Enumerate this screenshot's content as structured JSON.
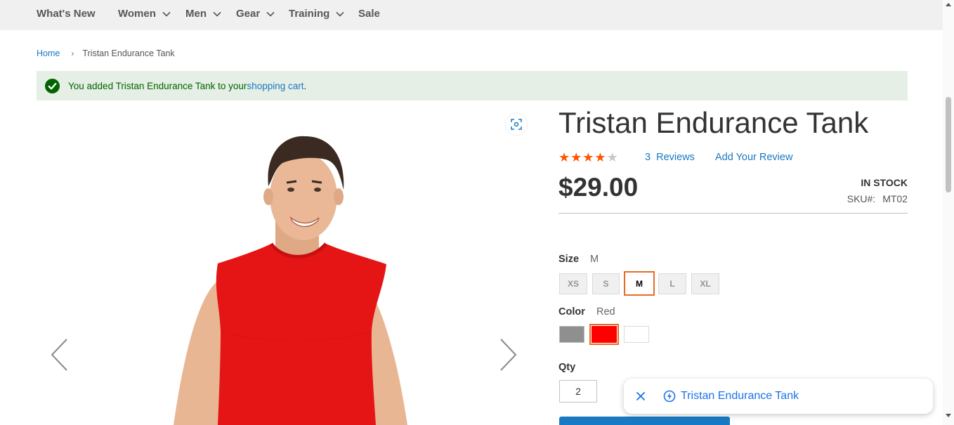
{
  "nav": {
    "items": [
      {
        "label": "What's New",
        "has_menu": false
      },
      {
        "label": "Women",
        "has_menu": true
      },
      {
        "label": "Men",
        "has_menu": true
      },
      {
        "label": "Gear",
        "has_menu": true
      },
      {
        "label": "Training",
        "has_menu": true
      },
      {
        "label": "Sale",
        "has_menu": false
      }
    ]
  },
  "breadcrumb": {
    "home": "Home",
    "separator": "›",
    "current": "Tristan Endurance Tank"
  },
  "message": {
    "prefix": "You added Tristan Endurance Tank to your ",
    "link": "shopping cart",
    "suffix": ".",
    "icon": "check-circle-icon"
  },
  "gallery": {
    "fullscreen_icon": "fullscreen-icon",
    "prev_icon": "chevron-left-icon",
    "next_icon": "chevron-right-icon"
  },
  "product": {
    "title": "Tristan Endurance Tank",
    "rating": 4,
    "rating_max": 5,
    "reviews_count": "3",
    "reviews_label": "Reviews",
    "add_review": "Add Your Review",
    "price": "$29.00",
    "stock": "IN STOCK",
    "sku_label": "SKU#:",
    "sku": "MT02",
    "accent_color": "#e96a24",
    "link_color": "#1979c3"
  },
  "options": {
    "size_label": "Size",
    "size_selected": "M",
    "sizes": [
      "XS",
      "S",
      "M",
      "L",
      "XL"
    ],
    "color_label": "Color",
    "color_selected": "Red",
    "colors": [
      {
        "name": "Gray",
        "hex": "#8f8f8f"
      },
      {
        "name": "Red",
        "hex": "#ff0000"
      },
      {
        "name": "White",
        "hex": "#ffffff"
      }
    ],
    "qty_label": "Qty",
    "qty_value": "2"
  },
  "toast": {
    "text": "Tristan Endurance Tank",
    "close_icon": "close-icon",
    "bolt_icon": "bolt-icon"
  }
}
